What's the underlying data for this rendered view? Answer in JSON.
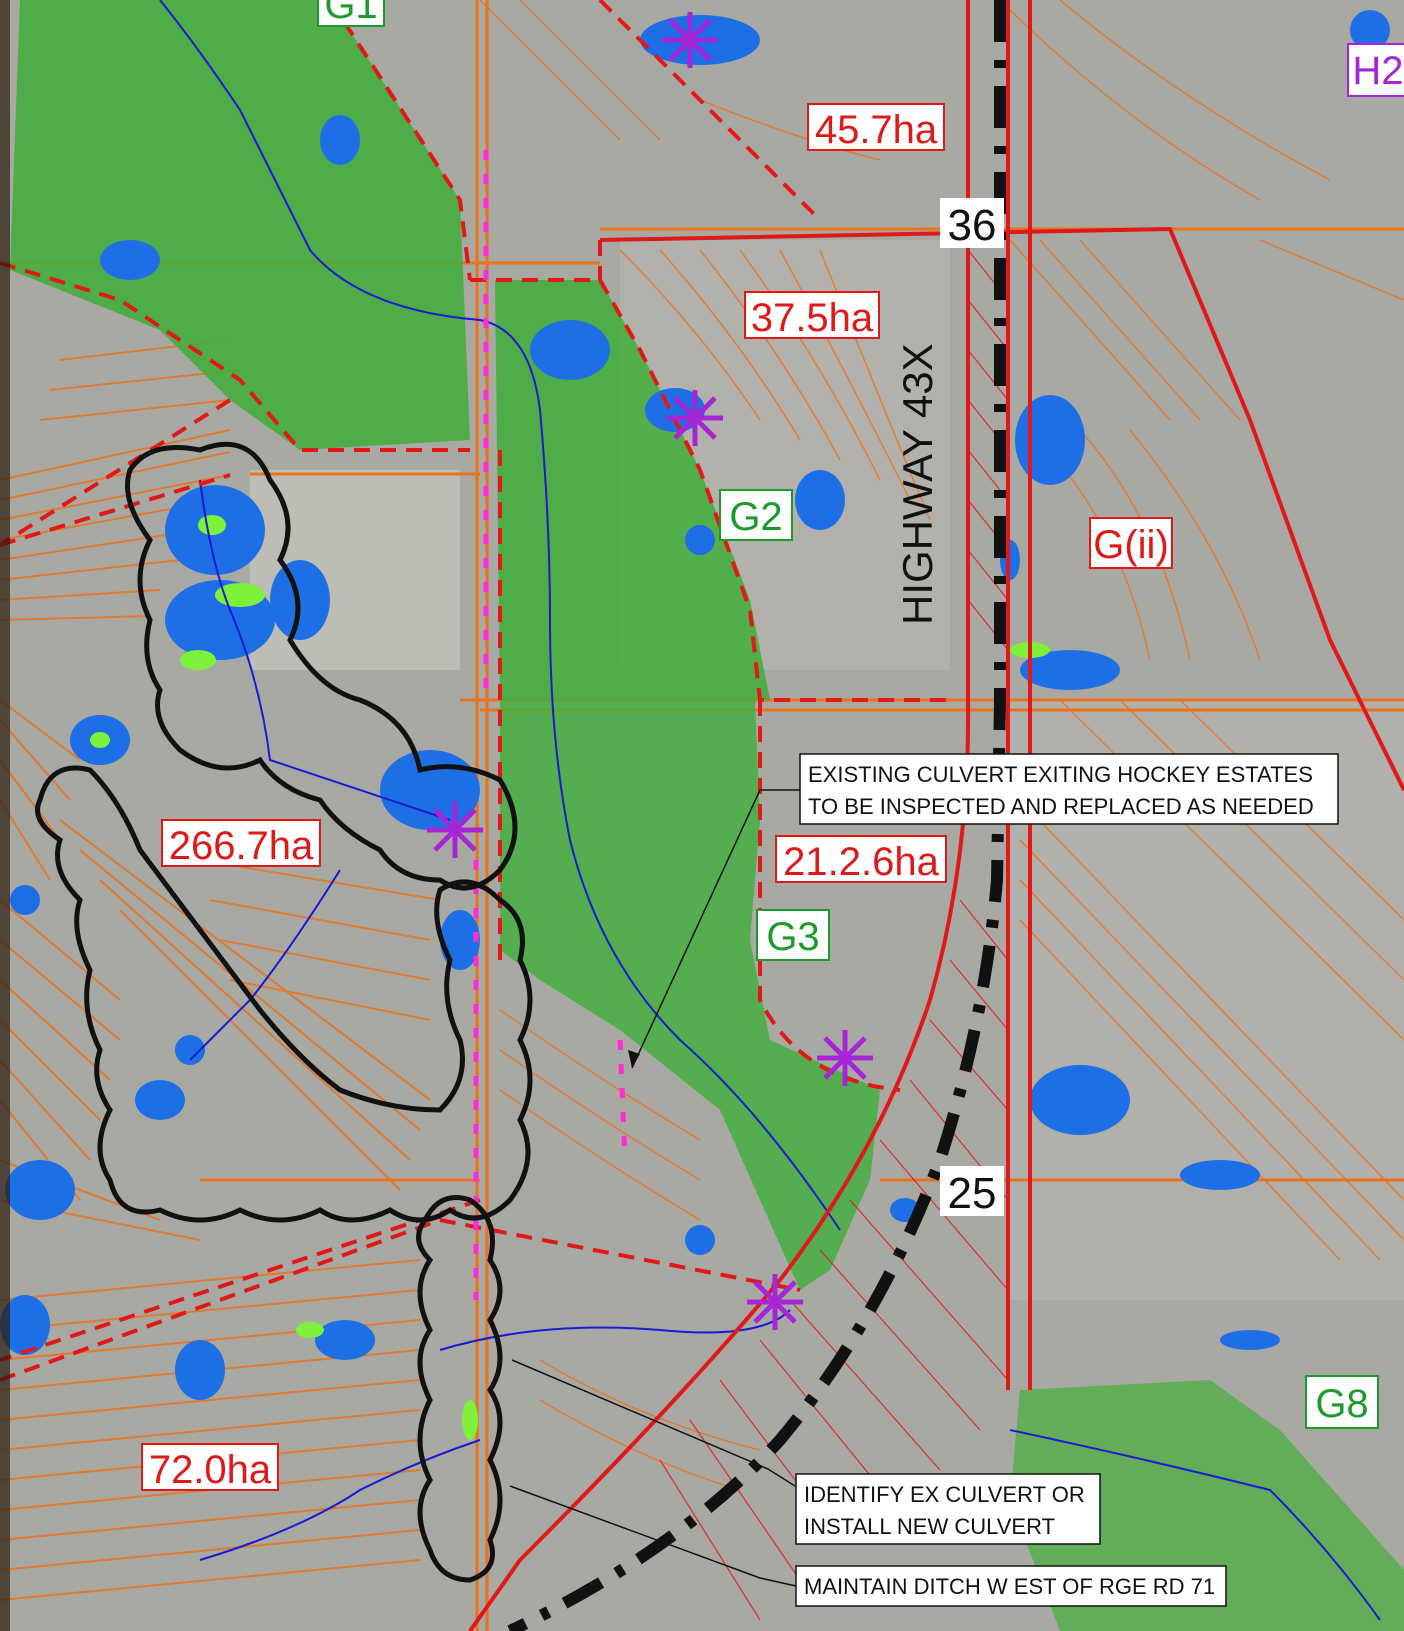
{
  "areas": {
    "a1": "45.7ha",
    "a2": "37.5ha",
    "a3": "266.7ha",
    "a4": "21.2.6ha",
    "a5": "72.0ha"
  },
  "zones": {
    "g1": "G1",
    "g2": "G2",
    "g3": "G3",
    "g8": "G8",
    "gii": "G(ii)",
    "h2": "H2"
  },
  "highway_label": "HIGHWAY 43X",
  "km_markers": {
    "upper": "36",
    "lower": "25"
  },
  "notes": {
    "culvert_hockey": [
      "EXISTING CULVERT EXITING HOCKEY ESTATES",
      "TO BE INSPECTED AND REPLACED AS NEEDED"
    ],
    "identify_culvert": [
      "IDENTIFY EX CULVERT OR",
      "INSTALL NEW CULVERT"
    ],
    "maintain_ditch": [
      "MAINTAIN DITCH W EST OF RGE RD 71"
    ]
  },
  "colors": {
    "field": "#a9a9a4",
    "contour": "#e9731c",
    "boundary": "#e01818",
    "wetland_blue": "#1e6fe6",
    "green_zone": "#3fae3a",
    "marker": "#a526d6",
    "cloud_outline": "#111111"
  }
}
